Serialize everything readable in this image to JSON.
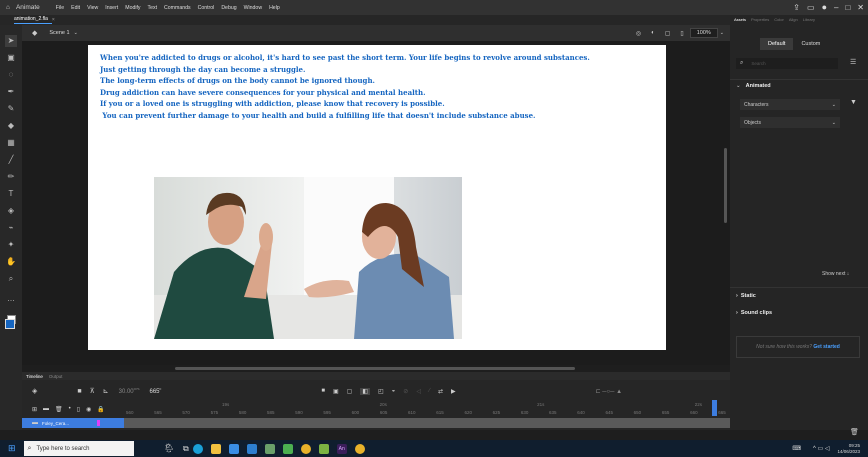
{
  "app": {
    "title": "Animate",
    "menu": [
      "File",
      "Edit",
      "View",
      "Insert",
      "Modify",
      "Text",
      "Commands",
      "Control",
      "Debug",
      "Window",
      "Help"
    ]
  },
  "doc": {
    "tab": "animation_2.fla"
  },
  "scene": {
    "name": "Scene 1",
    "zoom": "100%"
  },
  "stage": {
    "lines": [
      "When you're addicted to drugs or alcohol, it's hard to see past the short term. Your life begins to revolve around substances.",
      "Just getting through the day can become a struggle.",
      "The long-term effects of drugs on the body cannot be ignored though.",
      "Drug addiction can have severe consequences for your physical and mental health.",
      "If you or a loved one is struggling with addiction, please know that recovery is possible.",
      " You can prevent further damage to your health and build a fulfilling life that doesn't include substance abuse."
    ]
  },
  "timeline": {
    "tabs": [
      "Timeline",
      "Output"
    ],
    "fps": "30.00",
    "fps_unit": "FPS",
    "frame": "665",
    "frame_suffix": "F",
    "layer": "Foley_Cera...",
    "frames": [
      "560",
      "565",
      "570",
      "575",
      "580",
      "585",
      "590",
      "595",
      "600",
      "605",
      "610",
      "615",
      "620",
      "625",
      "630",
      "635",
      "640",
      "645",
      "650",
      "655",
      "660",
      "665"
    ],
    "seconds": [
      "19s",
      "20s",
      "21s",
      "22s"
    ]
  },
  "panel": {
    "tabs": [
      "Assets",
      "Properties",
      "Color",
      "Align",
      "Library"
    ],
    "btn_default": "Default",
    "btn_custom": "Custom",
    "search_placeholder": "Search",
    "section_animated": "Animated",
    "dd_characters": "Characters",
    "dd_objects": "Objects",
    "show_next": "Show next",
    "section_static": "Static",
    "section_sound": "Sound clips",
    "help_text": "Not sure how this works?",
    "help_link": "Get started"
  },
  "taskbar": {
    "search_placeholder": "Type here to search",
    "time": "09:25",
    "date": "14/06/2023"
  }
}
